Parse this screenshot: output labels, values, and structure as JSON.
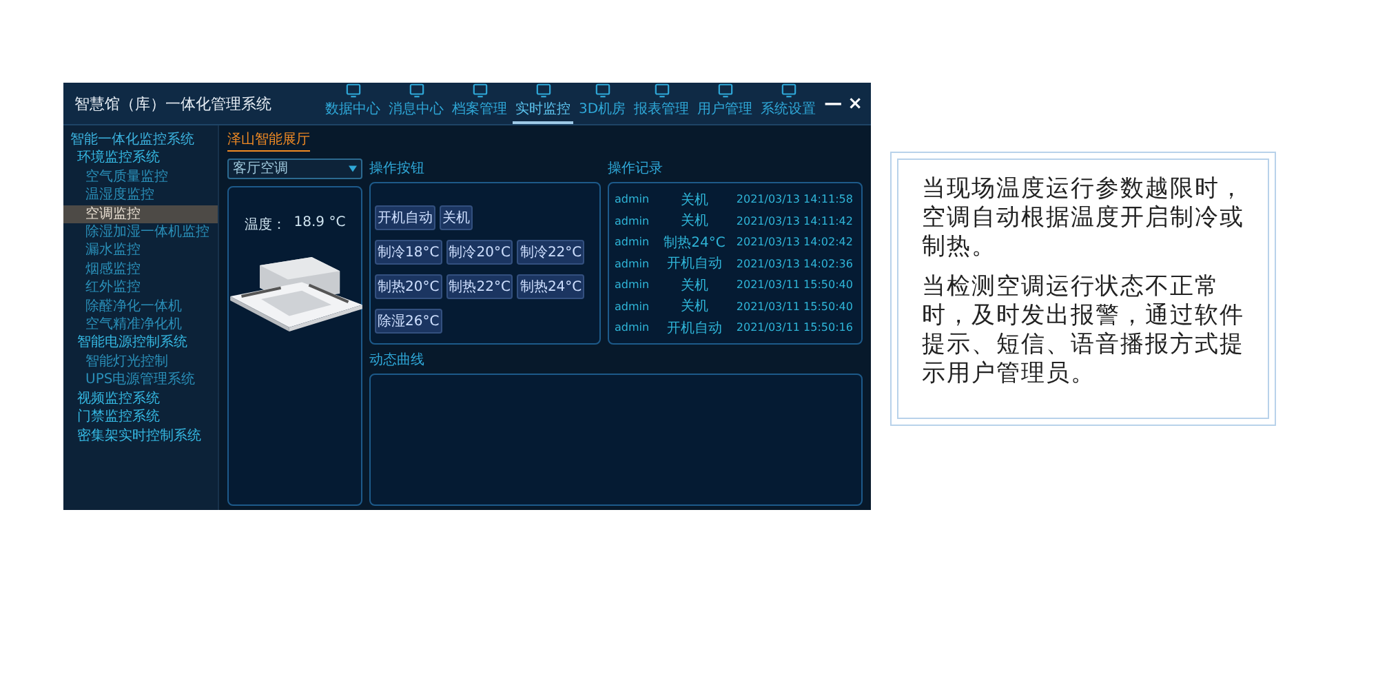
{
  "window": {
    "title": "智慧馆（库）一体化管理系统",
    "minimize": "—",
    "close": "×"
  },
  "nav": [
    {
      "label": "数据中心",
      "selected": false
    },
    {
      "label": "消息中心",
      "selected": false
    },
    {
      "label": "档案管理",
      "selected": false
    },
    {
      "label": "实时监控",
      "selected": true
    },
    {
      "label": "3D机房",
      "selected": false
    },
    {
      "label": "报表管理",
      "selected": false
    },
    {
      "label": "用户管理",
      "selected": false
    },
    {
      "label": "系统设置",
      "selected": false
    }
  ],
  "sidebar": {
    "items": [
      {
        "label": "智能一体化监控系统",
        "selected": false,
        "children": [
          {
            "label": "环境监控系统",
            "selected": false,
            "children": [
              {
                "label": "空气质量监控",
                "selected": false
              },
              {
                "label": "温湿度监控",
                "selected": false
              },
              {
                "label": "空调监控",
                "selected": true
              },
              {
                "label": "除湿加湿一体机监控",
                "selected": false
              },
              {
                "label": "漏水监控",
                "selected": false
              },
              {
                "label": "烟感监控",
                "selected": false
              },
              {
                "label": "红外监控",
                "selected": false
              },
              {
                "label": "除醛净化一体机",
                "selected": false
              },
              {
                "label": "空气精准净化机",
                "selected": false
              }
            ]
          },
          {
            "label": "智能电源控制系统",
            "selected": false,
            "children": [
              {
                "label": "智能灯光控制",
                "selected": false
              },
              {
                "label": "UPS电源管理系统",
                "selected": false
              }
            ]
          },
          {
            "label": "视频监控系统",
            "selected": false
          },
          {
            "label": "门禁监控系统",
            "selected": false
          },
          {
            "label": "密集架实时控制系统",
            "selected": false
          }
        ]
      }
    ]
  },
  "tab": {
    "label": "泽山智能展厅"
  },
  "device_select": {
    "value": "客厅空调"
  },
  "device_panel": {
    "reading_label": "温度：",
    "reading": "18.9 °C"
  },
  "controls": {
    "title": "操作按钮",
    "buttons": [
      [
        "开机自动",
        "关机"
      ],
      [
        "制冷18°C",
        "制冷20°C",
        "制冷22°C"
      ],
      [
        "制热20°C",
        "制热22°C",
        "制热24°C"
      ],
      [
        "除湿26°C"
      ]
    ]
  },
  "log": {
    "title": "操作记录",
    "rows": [
      [
        "admin",
        "关机",
        "2021/03/13 14:11:58"
      ],
      [
        "admin",
        "关机",
        "2021/03/13 14:11:42"
      ],
      [
        "admin",
        "制热24°C",
        "2021/03/13 14:02:42"
      ],
      [
        "admin",
        "开机自动",
        "2021/03/13 14:02:36"
      ],
      [
        "admin",
        "关机",
        "2021/03/11 15:50:40"
      ],
      [
        "admin",
        "关机",
        "2021/03/11 15:50:40"
      ],
      [
        "admin",
        "开机自动",
        "2021/03/11 15:50:16"
      ]
    ]
  },
  "chart_panel": {
    "title": "动态曲线"
  },
  "description": [
    "当现场温度运行参数越限时，空调自动根据温度开启制冷或制热。",
    "当检测空调运行状态不正常时，及时发出报警，通过软件提示、短信、语音播报方式提示用户管理员。"
  ]
}
